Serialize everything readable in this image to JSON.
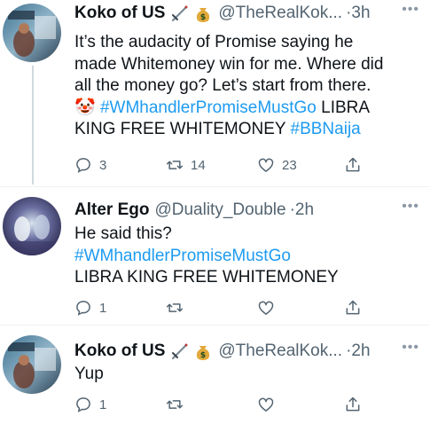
{
  "tweets": [
    {
      "name": "Koko of US",
      "handle": "@TheRealKok...",
      "dot": "·",
      "time": "3h",
      "more": "•••",
      "text_lines": [
        "It’s the audacity of Promise saying he",
        "made Whitemoney win for me. Where did",
        "all the money go? Let’s start from there."
      ],
      "line4_emoji": "🤡",
      "line4_hashtag": "#WMhandlerPromiseMustGo",
      "line4_tail": " LIBRA",
      "line5_text": "KING FREE WHITEMONEY ",
      "line5_hashtag": "#BBNaija",
      "stats": {
        "replies": "3",
        "retweets": "14",
        "likes": "23"
      }
    },
    {
      "name": "Alter Ego",
      "handle": "@Duality_Double",
      "dot": "·",
      "time": "2h",
      "more": "•••",
      "text_line1": "He said this?",
      "hashtag": "#WMhandlerPromiseMustGo",
      "text_line3": "LIBRA KING FREE WHITEMONEY",
      "stats": {
        "replies": "1",
        "retweets": "",
        "likes": ""
      }
    },
    {
      "name": "Koko of US",
      "handle": "@TheRealKok...",
      "dot": "·",
      "time": "2h",
      "more": "•••",
      "text_line1": "Yup",
      "stats": {
        "replies": "1",
        "retweets": "",
        "likes": ""
      }
    }
  ],
  "icons": {
    "badge1": "dagger-icon",
    "badge2": "money-bag-icon",
    "reply": "reply-icon",
    "retweet": "retweet-icon",
    "like": "like-icon",
    "share": "share-icon"
  },
  "colors": {
    "link": "#1d9bf0",
    "secondary": "#536471",
    "thread_line": "#cfd9de"
  }
}
